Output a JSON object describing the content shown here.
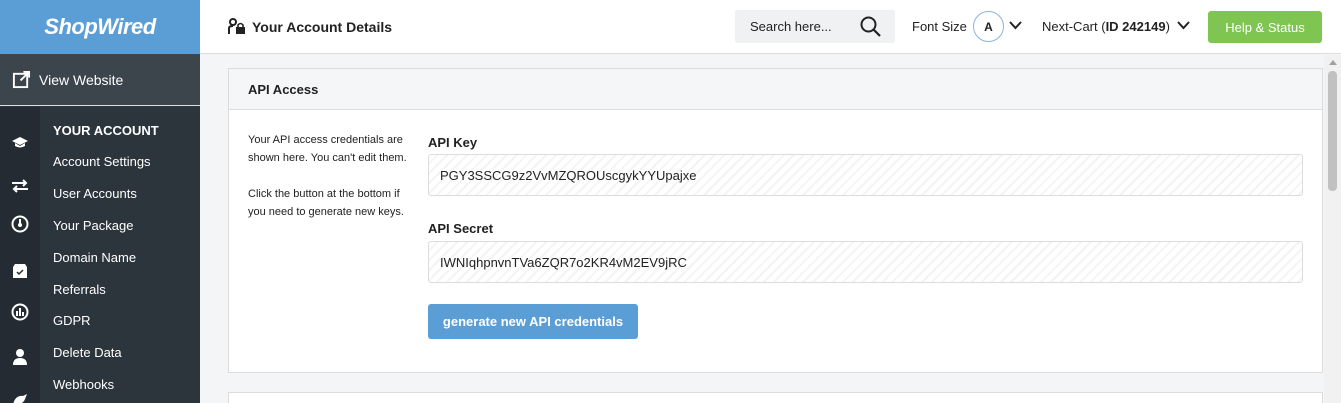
{
  "brand": {
    "logo_text": "ShopWired",
    "logo_color": "#5b9ed6"
  },
  "sidebar": {
    "view_website": "View Website",
    "section_heading": "YOUR ACCOUNT",
    "items": [
      {
        "label": "Account Settings"
      },
      {
        "label": "User Accounts"
      },
      {
        "label": "Your Package"
      },
      {
        "label": "Domain Name"
      },
      {
        "label": "Referrals"
      },
      {
        "label": "GDPR"
      },
      {
        "label": "Delete Data"
      },
      {
        "label": "Webhooks"
      }
    ],
    "icons": [
      "graduation-cap-icon",
      "arrows-exchange-icon",
      "gauge-icon",
      "box-icon",
      "chart-icon",
      "user-icon",
      "bird-icon"
    ]
  },
  "header": {
    "title": "Your Account Details",
    "search_placeholder": "Search here...",
    "font_size_label": "Font Size",
    "font_size_value": "A",
    "cart_name": "Next-Cart (",
    "cart_id": "ID 242149",
    "cart_close": ")",
    "help_label": "Help & Status",
    "help_color": "#7ec552"
  },
  "card": {
    "title": "API Access",
    "description_1": "Your API access credentials are shown here. You can't edit them.",
    "description_2": "Click the button at the bottom if you need to generate new keys.",
    "api_key_label": "API Key",
    "api_key_value": "PGY3SSCG9z2VvMZQROUscgykYYUpajxe",
    "api_secret_label": "API Secret",
    "api_secret_value": "IWNIqhpnvnTVa6ZQR7o2KR4vM2EV9jRC",
    "generate_label": "generate new API credentials",
    "generate_color": "#5b9ed6"
  }
}
